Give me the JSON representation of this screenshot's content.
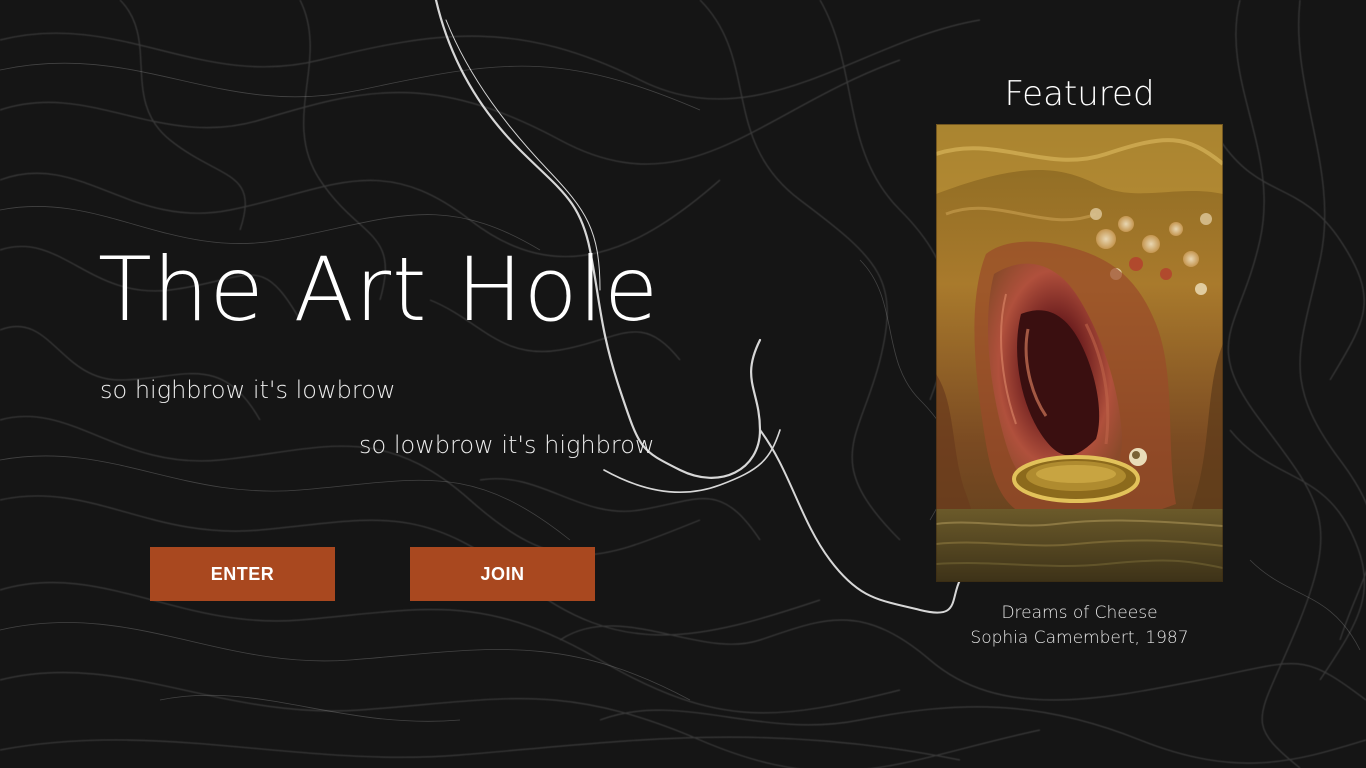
{
  "hero": {
    "title": "The Art Hole",
    "tagline_1": "so highbrow it's lowbrow",
    "tagline_2": "so lowbrow it's highbrow"
  },
  "actions": {
    "enter_label": "ENTER",
    "join_label": "JOIN"
  },
  "featured": {
    "heading": "Featured",
    "artwork_title": "Dreams of Cheese",
    "artwork_credit": "Sophia Camembert, 1987"
  },
  "colors": {
    "background": "#141414",
    "button": "#a9481f",
    "text": "#ffffff"
  }
}
